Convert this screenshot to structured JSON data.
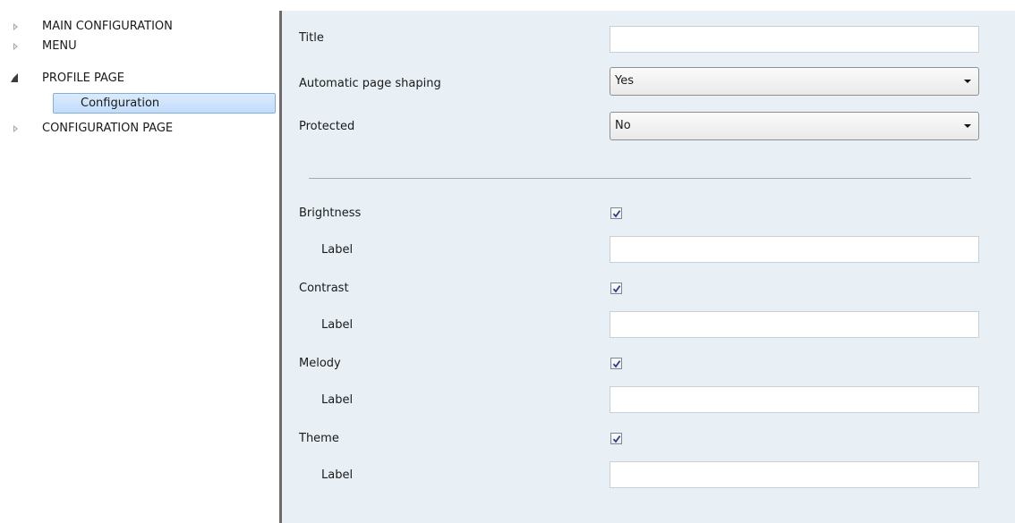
{
  "tree": {
    "items": [
      {
        "label": "MAIN CONFIGURATION",
        "state": "collapsed"
      },
      {
        "label": "MENU",
        "state": "collapsed"
      },
      {
        "label": "PROFILE PAGE",
        "state": "expanded"
      },
      {
        "label": "Configuration",
        "state": "selected-child"
      },
      {
        "label": "CONFIGURATION PAGE",
        "state": "collapsed"
      }
    ]
  },
  "form": {
    "title": {
      "label": "Title",
      "value": ""
    },
    "automatic_page_shaping": {
      "label": "Automatic page shaping",
      "value": "Yes"
    },
    "protected": {
      "label": "Protected",
      "value": "No"
    },
    "items": [
      {
        "label": "Brightness",
        "checked": true,
        "sub_label": "Label",
        "sub_value": ""
      },
      {
        "label": "Contrast",
        "checked": true,
        "sub_label": "Label",
        "sub_value": ""
      },
      {
        "label": "Melody",
        "checked": true,
        "sub_label": "Label",
        "sub_value": ""
      },
      {
        "label": "Theme",
        "checked": true,
        "sub_label": "Label",
        "sub_value": ""
      }
    ]
  },
  "colors": {
    "panel_bg": "#e8f0f6",
    "selection_bg": "#c9e0fa",
    "splitter": "#6a6a6a",
    "check": "#2b3a8c"
  }
}
